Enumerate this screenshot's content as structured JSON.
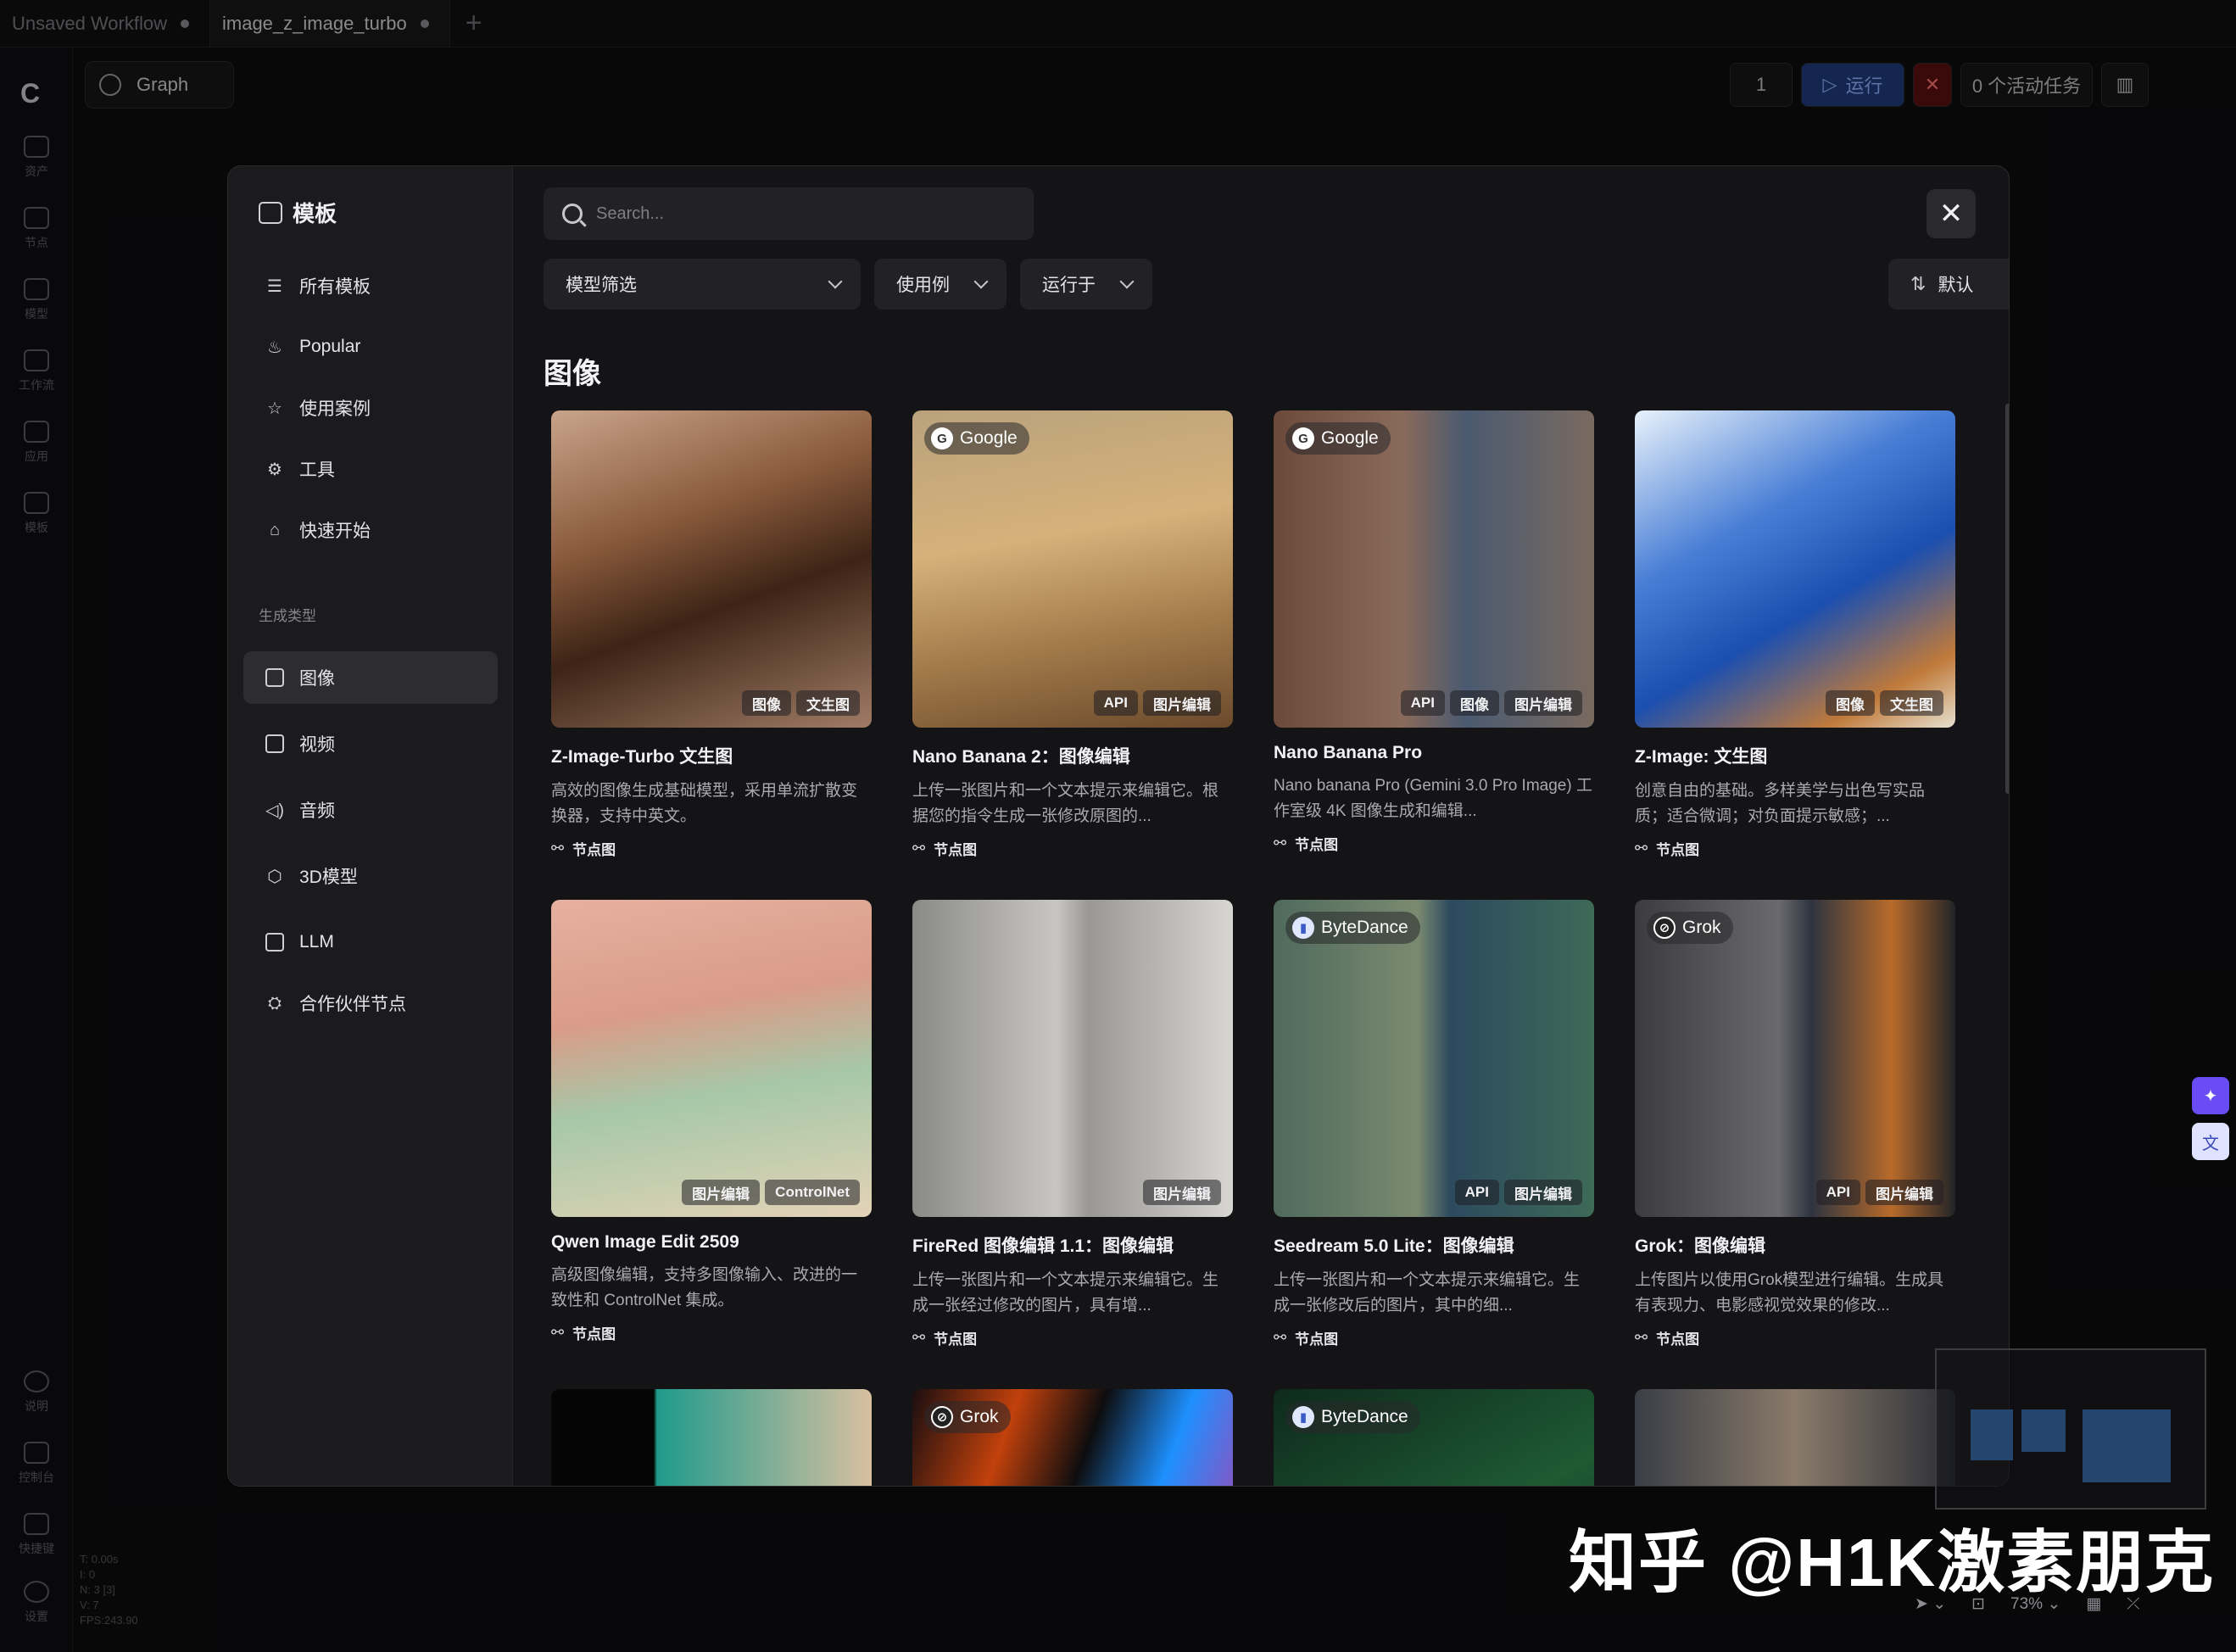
{
  "tabs": [
    {
      "label": "Unsaved Workflow"
    },
    {
      "label": "image_z_image_turbo"
    }
  ],
  "rail": {
    "items": [
      {
        "label": "资产"
      },
      {
        "label": "节点"
      },
      {
        "label": "模型"
      },
      {
        "label": "工作流"
      },
      {
        "label": "应用"
      },
      {
        "label": "模板"
      }
    ],
    "bottom": [
      {
        "label": "说明"
      },
      {
        "label": "控制台"
      },
      {
        "label": "快捷键"
      },
      {
        "label": "设置"
      }
    ],
    "stats": [
      "T: 0.00s",
      "I: 0",
      "N: 3 [3]",
      "V: 7",
      "FPS:243.90"
    ]
  },
  "header": {
    "graph_label": "Graph",
    "queue_count": "1",
    "run_label": "运行",
    "jobs_label": "0 个活动任务"
  },
  "modal": {
    "title": "模板",
    "nav": [
      {
        "label": "所有模板",
        "icon": "list-icon"
      },
      {
        "label": "Popular",
        "icon": "flame-icon"
      },
      {
        "label": "使用案例",
        "icon": "star-icon"
      },
      {
        "label": "工具",
        "icon": "gear-icon"
      },
      {
        "label": "快速开始",
        "icon": "graduation-cap-icon"
      }
    ],
    "section_label": "生成类型",
    "types": [
      {
        "label": "图像",
        "icon": "image-icon",
        "active": true
      },
      {
        "label": "视频",
        "icon": "film-icon"
      },
      {
        "label": "音频",
        "icon": "speaker-icon"
      },
      {
        "label": "3D模型",
        "icon": "cube-icon"
      },
      {
        "label": "LLM",
        "icon": "chat-icon"
      },
      {
        "label": "合作伙伴节点",
        "icon": "handshake-icon"
      }
    ],
    "search": {
      "placeholder": "Search..."
    },
    "filters": {
      "model": "模型筛选",
      "usecase": "使用例",
      "runs_on": "运行于",
      "sort": "默认"
    },
    "category_title": "图像",
    "cards": [
      {
        "title": "Z-Image-Turbo 文生图",
        "desc": "高效的图像生成基础模型，采用单流扩散变换器，支持中英文。",
        "kind": "节点图",
        "provider": "",
        "tags": [
          "图像",
          "文生图"
        ]
      },
      {
        "title": "Nano Banana 2：图像编辑",
        "desc": "上传一张图片和一个文本提示来编辑它。根据您的指令生成一张修改原图的...",
        "kind": "节点图",
        "provider": "Google",
        "tags": [
          "API",
          "图片编辑"
        ]
      },
      {
        "title": "Nano Banana Pro",
        "desc": "Nano banana Pro (Gemini 3.0 Pro Image) 工作室级 4K 图像生成和编辑...",
        "kind": "节点图",
        "provider": "Google",
        "tags": [
          "API",
          "图像",
          "图片编辑"
        ]
      },
      {
        "title": "Z-Image: 文生图",
        "desc": "创意自由的基础。多样美学与出色写实品质；适合微调；对负面提示敏感；...",
        "kind": "节点图",
        "provider": "",
        "tags": [
          "图像",
          "文生图"
        ]
      },
      {
        "title": "Qwen Image Edit 2509",
        "desc": "高级图像编辑，支持多图像输入、改进的一致性和 ControlNet 集成。",
        "kind": "节点图",
        "provider": "",
        "tags": [
          "图片编辑",
          "ControlNet"
        ]
      },
      {
        "title": "FireRed 图像编辑 1.1：图像编辑",
        "desc": "上传一张图片和一个文本提示来编辑它。生成一张经过修改的图片，具有增...",
        "kind": "节点图",
        "provider": "",
        "tags": [
          "图片编辑"
        ]
      },
      {
        "title": "Seedream 5.0 Lite：图像编辑",
        "desc": "上传一张图片和一个文本提示来编辑它。生成一张修改后的图片，其中的细...",
        "kind": "节点图",
        "provider": "ByteDance",
        "tags": [
          "API",
          "图片编辑"
        ]
      },
      {
        "title": "Grok：图像编辑",
        "desc": "上传图片以使用Grok模型进行编辑。生成具有表现力、电影感视觉效果的修改...",
        "kind": "节点图",
        "provider": "Grok",
        "tags": [
          "API",
          "图片编辑"
        ]
      },
      {
        "title": "",
        "desc": "",
        "kind": "",
        "provider": "",
        "tags": []
      },
      {
        "title": "",
        "desc": "",
        "kind": "",
        "provider": "Grok",
        "tags": []
      },
      {
        "title": "",
        "desc": "",
        "kind": "",
        "provider": "ByteDance",
        "tags": []
      },
      {
        "title": "",
        "desc": "",
        "kind": "",
        "provider": "",
        "tags": []
      }
    ]
  },
  "canvas": {
    "zoom": "73%"
  },
  "watermark": "知乎 @H1K激素朋克",
  "colors": {
    "accent": "#1f3a7a",
    "run_text": "#8db0ff",
    "stop": "#5a1010",
    "purple": "#6a4cf5"
  }
}
